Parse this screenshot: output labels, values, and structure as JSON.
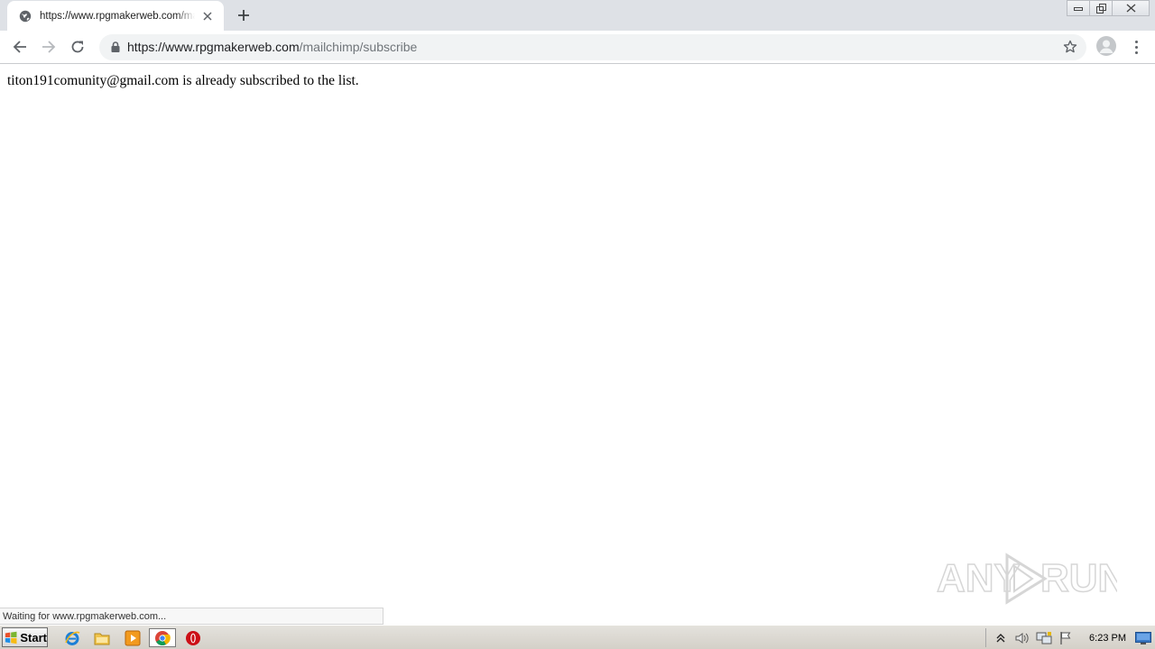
{
  "browser": {
    "tab": {
      "title": "https://www.rpgmakerweb.com/mailchimp/subscribe"
    },
    "address": {
      "host": "https://www.rpgmakerweb.com",
      "path": "/mailchimp/subscribe"
    },
    "status_text": "Waiting for www.rpgmakerweb.com..."
  },
  "page": {
    "message": "titon191comunity@gmail.com is already subscribed to the list."
  },
  "watermark": {
    "text": "ANY RUN"
  },
  "taskbar": {
    "start_label": "Start",
    "pinned": [
      "internet-explorer-icon",
      "folder-icon",
      "media-player-icon",
      "chrome-icon",
      "opera-icon"
    ],
    "clock": "6:23 PM"
  },
  "colors": {
    "tabstrip": "#dee1e6",
    "omnibox": "#f1f3f4",
    "taskbar": "#d4d0c8"
  }
}
